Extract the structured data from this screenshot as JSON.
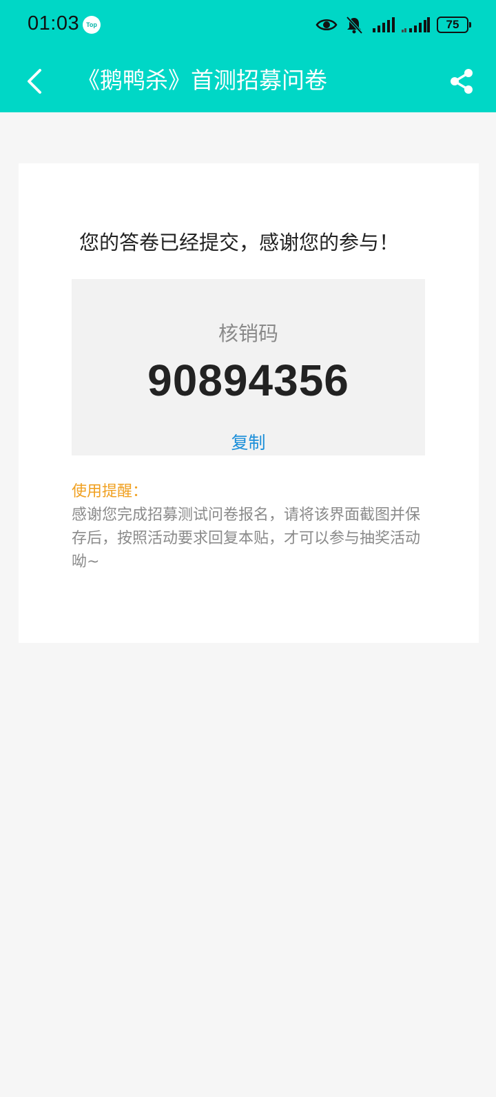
{
  "status_bar": {
    "time": "01:03",
    "app_badge": "Top",
    "battery": "75"
  },
  "nav": {
    "title": "《鹅鸭杀》首测招募问卷"
  },
  "card": {
    "thanks": "您的答卷已经提交，感谢您的参与！",
    "code_label": "核销码",
    "code_value": "90894356",
    "copy_label": "复制",
    "tip_title": "使用提醒：",
    "tip_body": "感谢您完成招募测试问卷报名，请将该界面截图并保存后，按照活动要求回复本贴，才可以参与抽奖活动呦~"
  },
  "colors": {
    "header_bg": "#00d7c6",
    "copy_link": "#1a8ed9",
    "tip_title": "#f0a020"
  },
  "icons": {
    "back": "chevron-left-icon",
    "share": "share-icon",
    "eye": "eye-icon",
    "bell_off": "bell-off-icon",
    "signal": "signal-icon"
  }
}
